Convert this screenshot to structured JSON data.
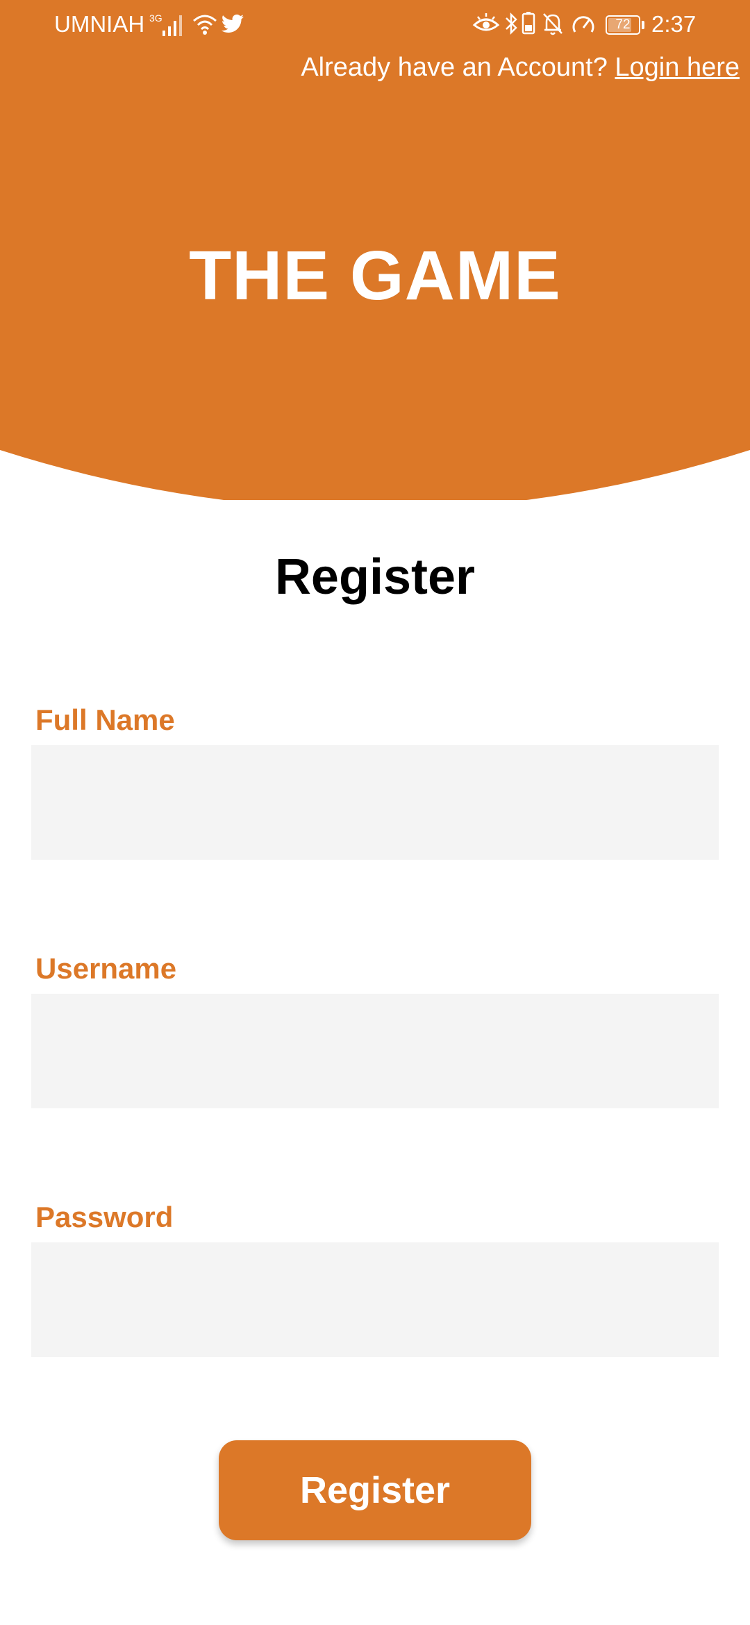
{
  "colors": {
    "accent": "#dc7828",
    "input_bg": "#f4f4f4",
    "title": "#000000",
    "on_accent": "#ffffff"
  },
  "status_bar": {
    "carrier": "UMNIAH",
    "network_type": "3G",
    "battery_level": "72",
    "time": "2:37",
    "icons": [
      "signal-icon",
      "wifi-icon",
      "twitter-icon",
      "eye-comfort-icon",
      "bluetooth-icon",
      "battery-saver-icon",
      "bell-off-icon",
      "speedometer-icon",
      "battery-icon"
    ]
  },
  "header": {
    "account_prompt": "Already have an Account?",
    "login_link": "Login here",
    "app_title": "THE GAME"
  },
  "form": {
    "title": "Register",
    "fields": {
      "full_name": {
        "label": "Full Name",
        "value": "",
        "placeholder": ""
      },
      "username": {
        "label": "Username",
        "value": "",
        "placeholder": ""
      },
      "password": {
        "label": "Password",
        "value": "",
        "placeholder": ""
      }
    },
    "submit_label": "Register"
  }
}
